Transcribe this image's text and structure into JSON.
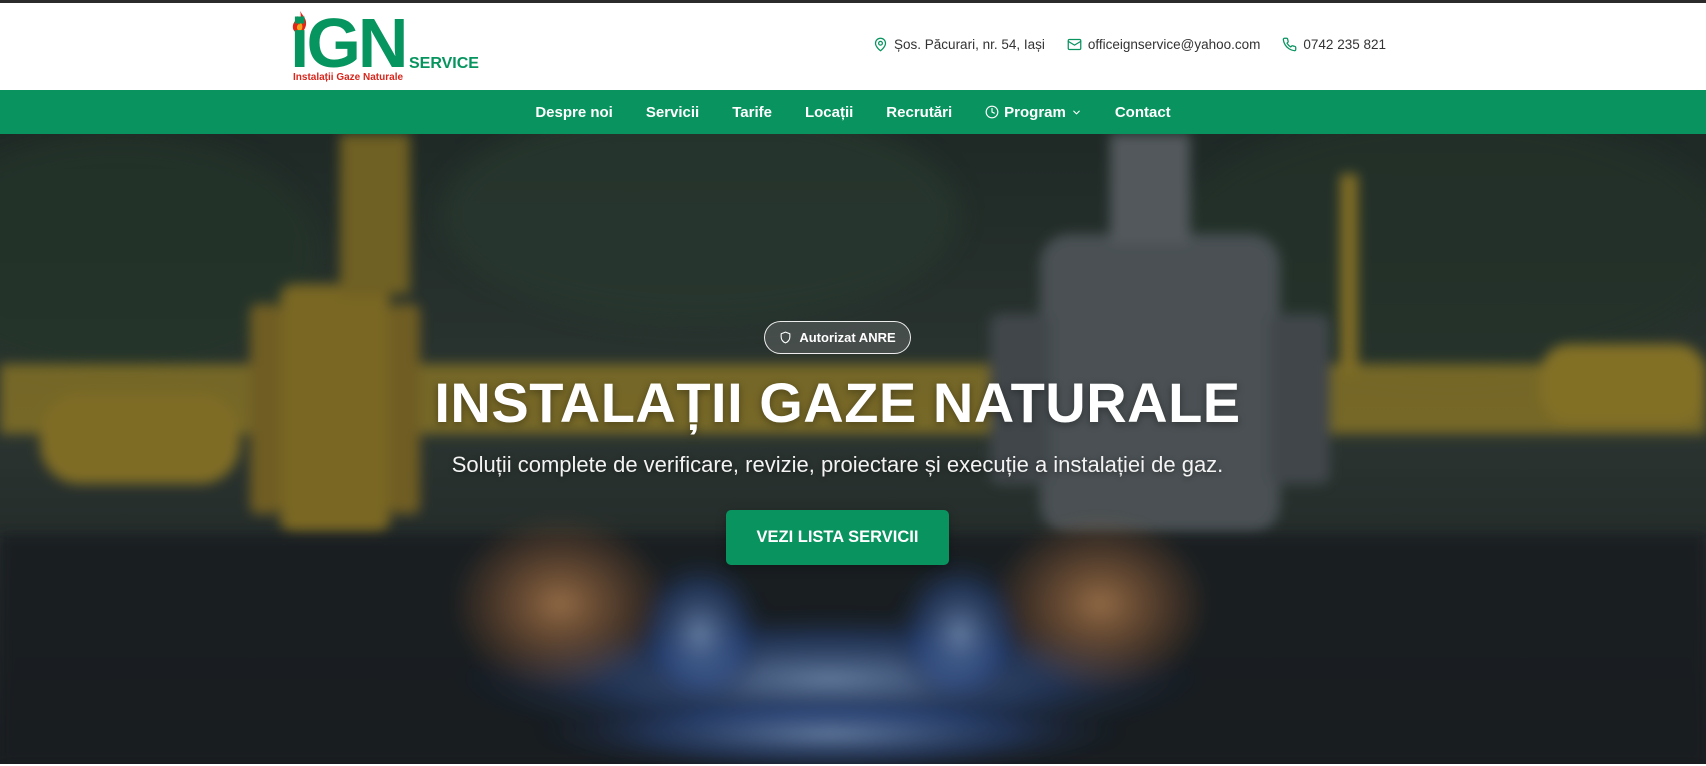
{
  "brand": {
    "logo_main": "iGN",
    "logo_service": "SERVICE",
    "logo_tagline": "Instalații Gaze Naturale",
    "colors": {
      "primary": "#08935f",
      "logo_red": "#d8261c"
    }
  },
  "contact": {
    "address": "Șos. Păcurari, nr. 54, Iași",
    "email": "officeignservice@yahoo.com",
    "phone": "0742 235 821",
    "icons": [
      "map-pin-icon",
      "mail-icon",
      "phone-icon"
    ]
  },
  "nav": {
    "items": [
      {
        "label": "Despre noi"
      },
      {
        "label": "Servicii"
      },
      {
        "label": "Tarife"
      },
      {
        "label": "Locații"
      },
      {
        "label": "Recrutări"
      },
      {
        "label": "Program",
        "icon": "clock-icon",
        "dropdown": true
      },
      {
        "label": "Contact"
      }
    ]
  },
  "hero": {
    "badge": "Autorizat ANRE",
    "badge_icon": "shield-icon",
    "title": "INSTALAȚII GAZE NATURALE",
    "subtitle": "Soluții complete de verificare, revizie, proiectare și execuție a instalației de gaz.",
    "cta_label": "VEZI LISTA SERVICII"
  }
}
